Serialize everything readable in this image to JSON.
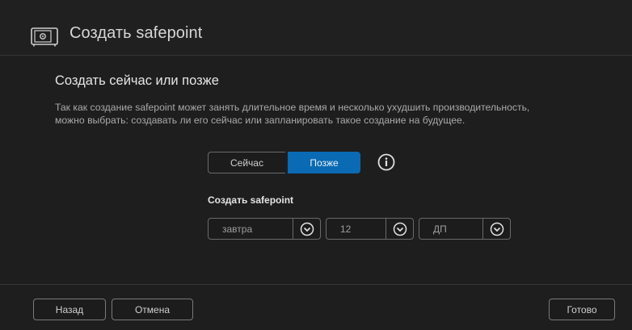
{
  "header": {
    "title": "Создать safepoint",
    "icon": "safe-icon"
  },
  "section": {
    "subtitle": "Создать сейчас или позже",
    "description_line1": "Так как создание safepoint может занять длительное время и несколько ухудшить производительность,",
    "description_line2": "можно выбрать: создавать ли его сейчас или запланировать такое создание на будущее."
  },
  "mode_toggle": {
    "now_label": "Сейчас",
    "later_label": "Позже",
    "selected": "later",
    "info_icon": "info-icon"
  },
  "schedule": {
    "label": "Создать safepoint",
    "day": "завтра",
    "hour": "12",
    "ampm": "ДП"
  },
  "footer": {
    "back_label": "Назад",
    "cancel_label": "Отмена",
    "done_label": "Готово"
  },
  "colors": {
    "accent": "#0a6ab3",
    "background": "#1e1e1e"
  }
}
